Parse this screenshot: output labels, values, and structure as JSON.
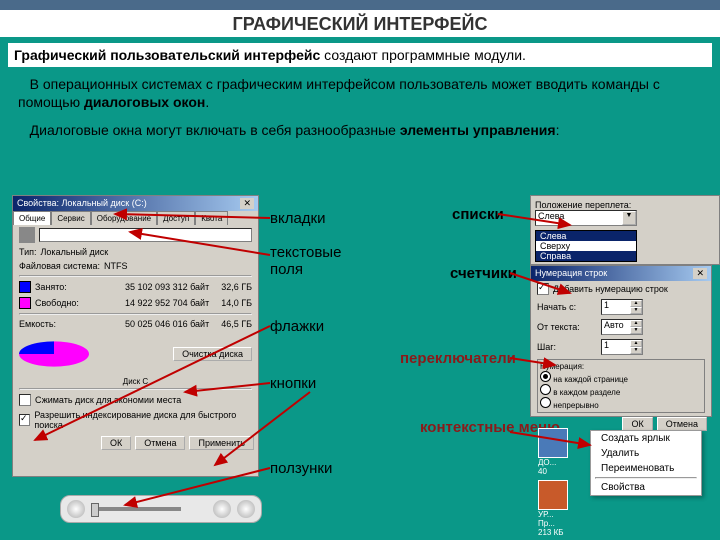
{
  "header": "ГРАФИЧЕСКИЙ ИНТЕРФЕЙС",
  "intro": {
    "t1": "Графический пользовательский интерфейс",
    "t2": " создают программные модули."
  },
  "p1": {
    "a": "В операционных системах с графическим интерфейсом пользователь может вводить команды с помощью ",
    "b": "диалоговых окон",
    "c": "."
  },
  "p2": {
    "a": "Диалоговые окна могут включать в себя разнообразные ",
    "b": "элементы управления",
    "c": ":"
  },
  "labels": {
    "tabs": "вкладки",
    "lists": "списки",
    "textfields": "текстовые поля",
    "spinners": "счетчики",
    "flags": "флажки",
    "radios": "переключатели",
    "buttons": "кнопки",
    "context": "контекстные меню",
    "sliders": "ползунки"
  },
  "dlg_props": {
    "title": "Свойства: Локальный диск (C:)",
    "tabs": [
      "Общие",
      "Сервис",
      "Оборудование",
      "Доступ",
      "Квота"
    ],
    "type_lbl": "Тип:",
    "type_val": "Локальный диск",
    "fs_lbl": "Файловая система:",
    "fs_val": "NTFS",
    "used_lbl": "Занято:",
    "used_bytes": "35 102 093 312 байт",
    "used_gb": "32,6 ГБ",
    "free_lbl": "Свободно:",
    "free_bytes": "14 922 952 704 байт",
    "free_gb": "14,0 ГБ",
    "cap_lbl": "Емкость:",
    "cap_bytes": "50 025 046 016 байт",
    "cap_gb": "46,5 ГБ",
    "disk_lbl": "Диск C",
    "cleanup": "Очистка диска",
    "chk1": "Сжимать диск для экономии места",
    "chk2": "Разрешить индексирование диска для быстрого поиска",
    "ok": "ОК",
    "cancel": "Отмена",
    "apply": "Применить",
    "colors": {
      "used": "#0000ff",
      "free": "#ff00ff"
    }
  },
  "dlg_list": {
    "label": "Положение переплета:",
    "options": [
      "Слева",
      "Сверху",
      "Справа"
    ],
    "selected": "Слева"
  },
  "dlg_num": {
    "title": "Нумерация строк",
    "chk": "Добавить нумерацию строк",
    "from_lbl": "Начать с:",
    "from_val": "1",
    "dist_lbl": "От текста:",
    "dist_val": "Авто",
    "step_lbl": "Шаг:",
    "step_val": "1",
    "grp": "Нумерация:",
    "r1": "на каждой странице",
    "r2": "в каждом разделе",
    "r3": "непрерывно",
    "ok": "ОК",
    "cancel": "Отмена"
  },
  "ctx": {
    "items": [
      "Создать ярлык",
      "Удалить",
      "Переименовать",
      "",
      "Свойства"
    ]
  },
  "file_icons": {
    "doc": "ДО...",
    "size1": "40",
    "ppt": "УР...",
    "type": "Пр...",
    "size2": "213 КБ"
  }
}
